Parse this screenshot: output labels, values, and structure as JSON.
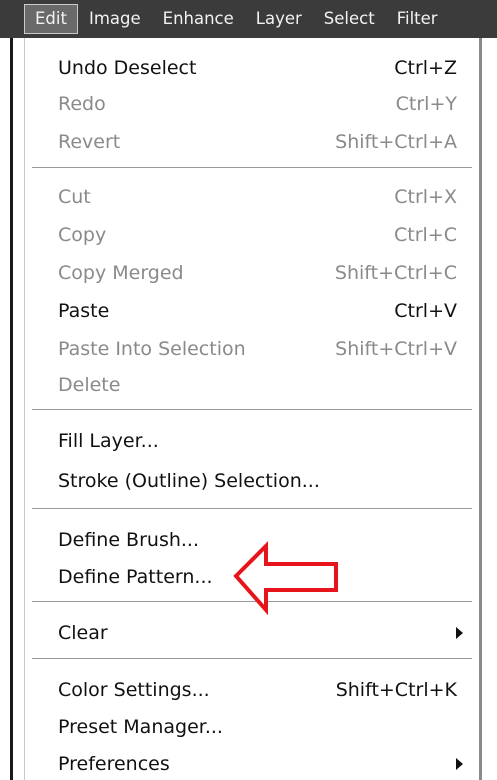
{
  "menubar": {
    "items": [
      {
        "label": "Edit",
        "active": true
      },
      {
        "label": "Image"
      },
      {
        "label": "Enhance"
      },
      {
        "label": "Layer"
      },
      {
        "label": "Select"
      },
      {
        "label": "Filter"
      }
    ]
  },
  "edit_menu": {
    "items": [
      {
        "label": "Undo Deselect",
        "shortcut": "Ctrl+Z",
        "enabled": true
      },
      {
        "label": "Redo",
        "shortcut": "Ctrl+Y",
        "enabled": false
      },
      {
        "label": "Revert",
        "shortcut": "Shift+Ctrl+A",
        "enabled": false
      },
      {
        "label": "Cut",
        "shortcut": "Ctrl+X",
        "enabled": false
      },
      {
        "label": "Copy",
        "shortcut": "Ctrl+C",
        "enabled": false
      },
      {
        "label": "Copy Merged",
        "shortcut": "Shift+Ctrl+C",
        "enabled": false
      },
      {
        "label": "Paste",
        "shortcut": "Ctrl+V",
        "enabled": true
      },
      {
        "label": "Paste Into Selection",
        "shortcut": "Shift+Ctrl+V",
        "enabled": false
      },
      {
        "label": "Delete",
        "shortcut": "",
        "enabled": false
      },
      {
        "label": "Fill Layer...",
        "shortcut": "",
        "enabled": true
      },
      {
        "label": "Stroke (Outline) Selection...",
        "shortcut": "",
        "enabled": true
      },
      {
        "label": "Define Brush...",
        "shortcut": "",
        "enabled": true
      },
      {
        "label": "Define Pattern...",
        "shortcut": "",
        "enabled": true
      },
      {
        "label": "Clear",
        "shortcut": "",
        "enabled": true,
        "submenu": true
      },
      {
        "label": "Color Settings...",
        "shortcut": "Shift+Ctrl+K",
        "enabled": true
      },
      {
        "label": "Preset Manager...",
        "shortcut": "",
        "enabled": true
      },
      {
        "label": "Preferences",
        "shortcut": "",
        "enabled": true,
        "submenu": true
      }
    ]
  },
  "annotation": {
    "arrow_color": "#e8141b",
    "points_to": "Define Pattern..."
  }
}
